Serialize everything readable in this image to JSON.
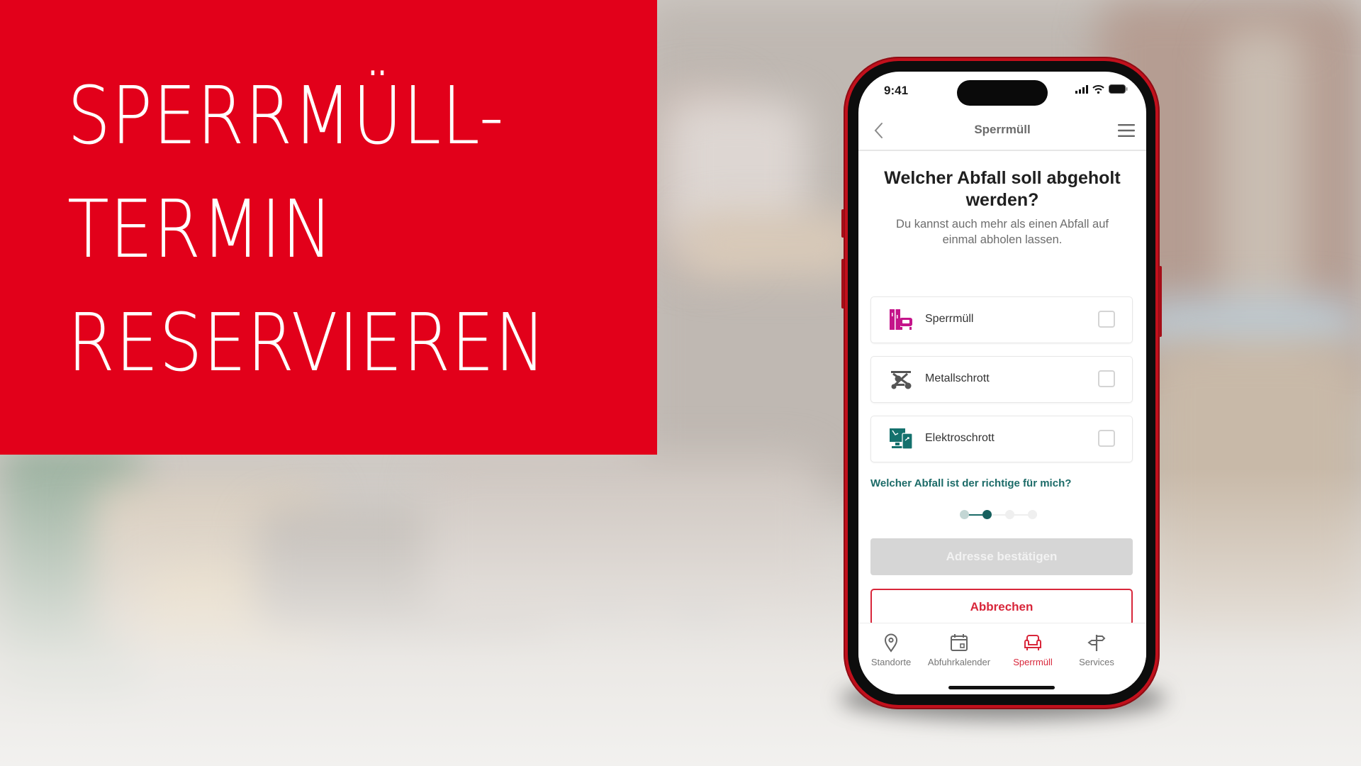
{
  "colors": {
    "brand_red": "#e2001a",
    "phone_red": "#c2101c",
    "accent_red": "#d8263a",
    "teal": "#1c6b68",
    "magenta_icon": "#c4148a",
    "teal_icon": "#14716d",
    "grey_icon": "#555555"
  },
  "banner": {
    "lines": [
      "SPERRMÜLL-",
      "TERMIN",
      "RESERVIEREN"
    ]
  },
  "phone": {
    "status_bar": {
      "time": "9:41",
      "icons": [
        "signal-icon",
        "wifi-icon",
        "battery-icon"
      ]
    },
    "navbar": {
      "back_icon": "chevron-left-icon",
      "title": "Sperrmüll",
      "menu_icon": "hamburger-menu-icon"
    },
    "heading": "Welcher Abfall soll abgeholt werden?",
    "subtext": "Du kannst auch mehr als einen Abfall auf einmal abholen lassen.",
    "options": [
      {
        "label": "Sperrmüll",
        "icon": "furniture-icon",
        "checked": false
      },
      {
        "label": "Metallschrott",
        "icon": "scrap-metal-icon",
        "checked": false
      },
      {
        "label": "Elektroschrott",
        "icon": "electronics-icon",
        "checked": false
      }
    ],
    "help_link": "Welcher Abfall ist der richtige für mich?",
    "stepper": {
      "total_steps": 4,
      "current_step": 2
    },
    "confirm_button": {
      "label": "Adresse bestätigen",
      "enabled": false
    },
    "cancel_button": {
      "label": "Abbrechen"
    },
    "tabbar": {
      "active_index": 2,
      "tabs": [
        {
          "label": "Standorte",
          "icon": "location-pin-icon"
        },
        {
          "label": "Abfuhrkalender",
          "icon": "calendar-icon"
        },
        {
          "label": "Sperrmüll",
          "icon": "armchair-icon"
        },
        {
          "label": "Services",
          "icon": "signpost-icon"
        }
      ]
    }
  }
}
